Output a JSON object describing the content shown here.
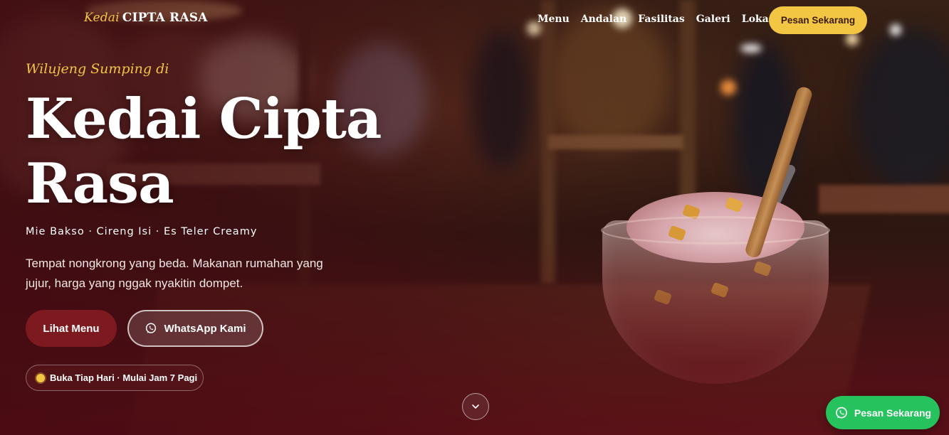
{
  "header": {
    "logo_script": "Kedai",
    "logo_brand": "CIPTA RASA",
    "nav": [
      "Menu",
      "Andalan",
      "Fasilitas",
      "Galeri",
      "Lokasi"
    ],
    "cta_label": "Pesan Sekarang"
  },
  "hero": {
    "eyebrow": "Wilujeng Sumping di",
    "title_line1": "Kedai Cipta",
    "title_line2": "Rasa",
    "subtitle": "Mie Bakso · Cireng Isi · Es Teler Creamy",
    "description": "Tempat nongkrong yang beda. Makanan rumahan yang jujur, harga yang nggak nyakitin dompet.",
    "primary_button": "Lihat Menu",
    "secondary_button": "WhatsApp Kami",
    "secondary_icon": "whatsapp-icon",
    "badge": "Buka Tiap Hari · Mulai Jam 7 Pagi"
  },
  "floating_whatsapp": {
    "label": "Pesan Sekarang",
    "icon": "whatsapp-icon"
  },
  "colors": {
    "accent_yellow": "#f2c542",
    "primary_maroon": "#7d1a1f",
    "whatsapp_green": "#25c25d"
  }
}
